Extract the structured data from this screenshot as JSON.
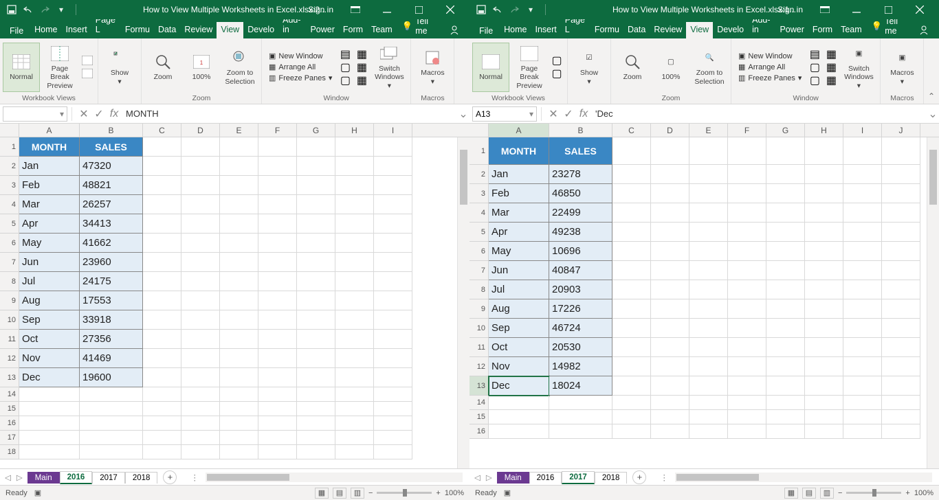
{
  "left": {
    "title": "How to View Multiple Worksheets in Excel.xlsx:2...",
    "signin": "Sign in",
    "tabs": [
      "File",
      "Home",
      "Insert",
      "Page L",
      "Formu",
      "Data",
      "Review",
      "View",
      "Develo",
      "Add-in",
      "Power",
      "Form",
      "Team"
    ],
    "activeTab": "View",
    "tellme": "Tell me",
    "ribbon": {
      "g1": {
        "normal": "Normal",
        "pbp": "Page Break\nPreview",
        "label": "Workbook Views"
      },
      "g2": {
        "zoom": "Zoom",
        "p100": "100%",
        "zsel": "Zoom to\nSelection",
        "label": "Zoom",
        "show": "Show"
      },
      "g3": {
        "nw": "New Window",
        "aa": "Arrange All",
        "fp": "Freeze Panes",
        "sw": "Switch\nWindows",
        "label": "Window"
      },
      "g4": {
        "mac": "Macros",
        "label": "Macros"
      }
    },
    "namebox": "",
    "formula": "MONTH",
    "cols": [
      "A",
      "B",
      "C",
      "D",
      "E",
      "F",
      "G",
      "H",
      "I"
    ],
    "headers": {
      "a": "MONTH",
      "b": "SALES"
    },
    "data": [
      [
        "Jan",
        "47320"
      ],
      [
        "Feb",
        "48821"
      ],
      [
        "Mar",
        "26257"
      ],
      [
        "Apr",
        "34413"
      ],
      [
        "May",
        "41662"
      ],
      [
        "Jun",
        "23960"
      ],
      [
        "Jul",
        "24175"
      ],
      [
        "Aug",
        "17553"
      ],
      [
        "Sep",
        "33918"
      ],
      [
        "Oct",
        "27356"
      ],
      [
        "Nov",
        "41469"
      ],
      [
        "Dec",
        "19600"
      ]
    ],
    "sheets": [
      "Main",
      "2016",
      "2017",
      "2018"
    ],
    "activeSheet": "2016",
    "status": {
      "ready": "Ready",
      "zoom": "100%"
    }
  },
  "right": {
    "title": "How to View Multiple Worksheets in Excel.xlsx:1...",
    "signin": "Sign in",
    "tabs": [
      "File",
      "Home",
      "Insert",
      "Page L",
      "Formu",
      "Data",
      "Review",
      "View",
      "Develo",
      "Add-in",
      "Power",
      "Form",
      "Team"
    ],
    "activeTab": "View",
    "tellme": "Tell me",
    "ribbon": {
      "g1": {
        "normal": "Normal",
        "pbp": "Page Break\nPreview",
        "label": "Workbook Views"
      },
      "g2": {
        "zoom": "Zoom",
        "p100": "100%",
        "zsel": "Zoom to\nSelection",
        "label": "Zoom",
        "show": "Show"
      },
      "g3": {
        "nw": "New Window",
        "aa": "Arrange All",
        "fp": "Freeze Panes",
        "sw": "Switch\nWindows",
        "label": "Window"
      },
      "g4": {
        "mac": "Macros",
        "label": "Macros"
      }
    },
    "namebox": "A13",
    "formula": "'Dec",
    "cols": [
      "A",
      "B",
      "C",
      "D",
      "E",
      "F",
      "G",
      "H",
      "I",
      "J"
    ],
    "headers": {
      "a": "MONTH",
      "b": "SALES"
    },
    "data": [
      [
        "Jan",
        "23278"
      ],
      [
        "Feb",
        "46850"
      ],
      [
        "Mar",
        "22499"
      ],
      [
        "Apr",
        "49238"
      ],
      [
        "May",
        "10696"
      ],
      [
        "Jun",
        "40847"
      ],
      [
        "Jul",
        "20903"
      ],
      [
        "Aug",
        "17226"
      ],
      [
        "Sep",
        "46724"
      ],
      [
        "Oct",
        "20530"
      ],
      [
        "Nov",
        "14982"
      ],
      [
        "Dec",
        "18024"
      ]
    ],
    "sheets": [
      "Main",
      "2016",
      "2017",
      "2018"
    ],
    "activeSheet": "2017",
    "status": {
      "ready": "Ready",
      "zoom": "100%"
    }
  }
}
